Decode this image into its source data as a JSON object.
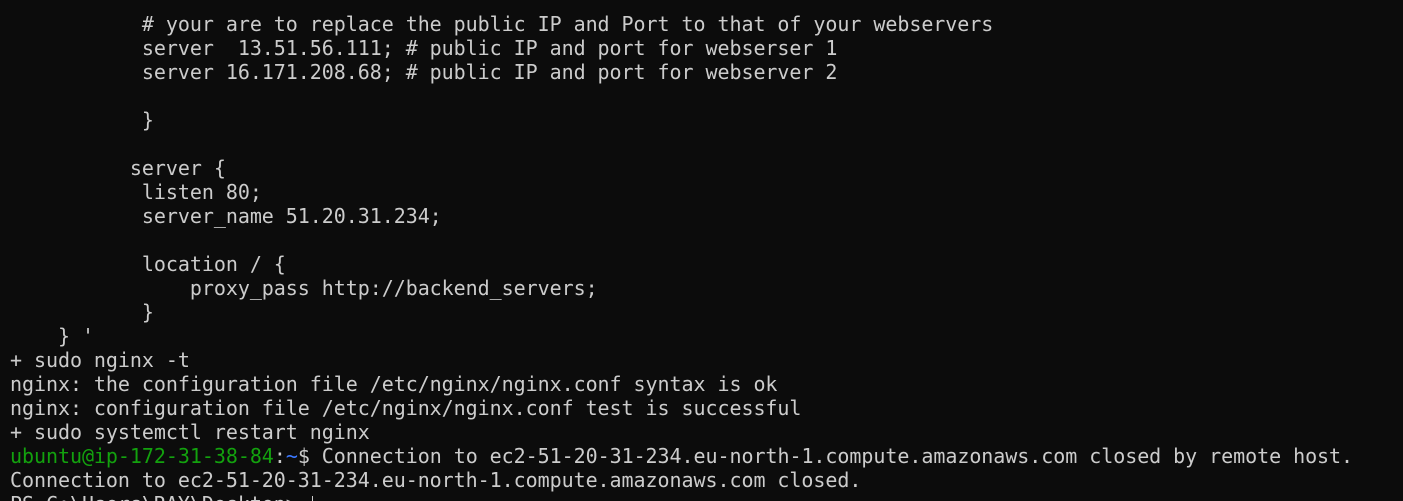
{
  "terminal": {
    "lines": [
      "           # your are to replace the public IP and Port to that of your webservers",
      "           server  13.51.56.111; # public IP and port for webserser 1",
      "           server 16.171.208.68; # public IP and port for webserver 2",
      "",
      "           }",
      "",
      "          server {",
      "           listen 80;",
      "           server_name 51.20.31.234;",
      "",
      "           location / {",
      "               proxy_pass http://backend_servers;",
      "           }",
      "    } '",
      "+ sudo nginx -t",
      "nginx: the configuration file /etc/nginx/nginx.conf syntax is ok",
      "nginx: configuration file /etc/nginx/nginx.conf test is successful",
      "+ sudo systemctl restart nginx"
    ],
    "ssh_prompt": {
      "user_host": "ubuntu@ip-172-31-38-84",
      "separator": ":",
      "path": "~",
      "symbol": "$",
      "message": " Connection to ec2-51-20-31-234.eu-north-1.compute.amazonaws.com closed by remote host."
    },
    "closed_line": "Connection to ec2-51-20-31-234.eu-north-1.compute.amazonaws.com closed.",
    "ps_prompt": "PS C:\\Users\\RAY\\Desktop> ",
    "colors": {
      "background": "#0c0c0c",
      "text": "#cccccc",
      "prompt_user": "#13a10e",
      "prompt_path": "#3b78ff"
    }
  }
}
